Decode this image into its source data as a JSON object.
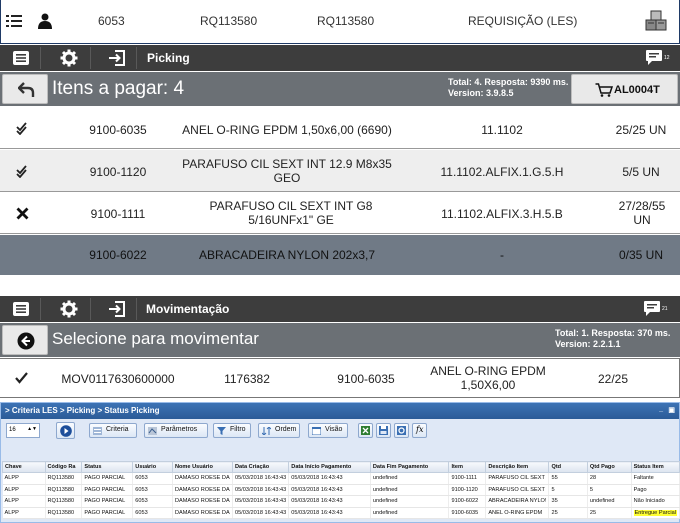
{
  "request_bar": {
    "code": "6053",
    "req_id_1": "RQ113580",
    "req_id_2": "RQ113580",
    "type": "REQUISIÇÃO (LES)",
    "icons": [
      "list-icon",
      "user-icon",
      "boxes-icon"
    ]
  },
  "picking": {
    "toolbar": {
      "title": "Picking",
      "badge": "12"
    },
    "header": {
      "title": "Itens a pagar: 4",
      "stats_line1": "Total: 4. Resposta: 9390 ms.",
      "stats_line2": "Version: 3.9.8.5",
      "cart_label": "AL0004T"
    },
    "rows": [
      {
        "status_icon": "double-check-icon",
        "item": "9100-6035",
        "desc": "ANEL O-RING EPDM 1,50x6,00 (6690)",
        "loc": "11.1102",
        "qty": "25/25 UN"
      },
      {
        "status_icon": "double-check-icon",
        "item": "9100-1120",
        "desc": "PARAFUSO CIL SEXT INT 12.9  M8x35 GEO",
        "loc": "11.1102.ALFIX.1.G.5.H",
        "qty": "5/5 UN"
      },
      {
        "status_icon": "x-icon",
        "item": "9100-1111",
        "desc": "PARAFUSO CIL SEXT INT G8 5/16UNFx1\" GE",
        "loc": "11.1102.ALFIX.3.H.5.B",
        "qty": "27/28/55 UN"
      },
      {
        "status_icon": "",
        "item": "9100-6022",
        "desc": "ABRACADEIRA NYLON 202x3,7",
        "loc": "-",
        "qty": "0/35 UN"
      }
    ]
  },
  "movimentacao": {
    "toolbar": {
      "title": "Movimentação",
      "badge": "21"
    },
    "header": {
      "title": "Selecione para movimentar",
      "stats_line1": "Total: 1. Resposta: 370 ms.",
      "stats_line2": "Version: 2.2.1.1"
    },
    "row": {
      "status_icon": "check-icon",
      "mov": "MOV0117630600000",
      "code": "1176382",
      "item": "9100-6035",
      "desc": "ANEL O-RING EPDM 1,50X6,00",
      "qty": "22/25"
    }
  },
  "criteria": {
    "breadcrumb": "> Criteria LES > Picking > Status Picking",
    "page_size": "16",
    "buttons": {
      "criteria": "Criteria",
      "params": "Parâmetros",
      "filter": "Filtro",
      "order": "Ordem",
      "view": "Visão"
    },
    "columns": [
      "Chave",
      "Código Ra",
      "Status",
      "Usuário",
      "Nome Usuário",
      "Data Criação",
      "Data Início Pagamento",
      "Data Fim Pagamento",
      "Item",
      "Descrição Item",
      "Qtd",
      "Qtd Pago",
      "Status Item"
    ],
    "rows": [
      [
        "ALPP",
        "RQ113580",
        "PAGO PARCIAL",
        "6053",
        "DAMASO ROESE DA",
        "05/03/2018 16:43:43",
        "05/03/2018 16:43:43",
        "undefined",
        "9100-1111",
        "PARAFUSO CIL SEXT",
        "55",
        "28",
        "Faltante"
      ],
      [
        "ALPP",
        "RQ113580",
        "PAGO PARCIAL",
        "6053",
        "DAMASO ROESE DA",
        "05/03/2018 16:43:43",
        "05/03/2018 16:43:43",
        "undefined",
        "9100-1120",
        "PARAFUSO CIL SEXT",
        "5",
        "5",
        "Pago"
      ],
      [
        "ALPP",
        "RQ113580",
        "PAGO PARCIAL",
        "6053",
        "DAMASO ROESE DA",
        "05/03/2018 16:43:43",
        "05/03/2018 16:43:43",
        "undefined",
        "9100-6022",
        "ABRACADEIRA NYLO!",
        "35",
        "undefined",
        "Não Iniciado"
      ],
      [
        "ALPP",
        "RQ113580",
        "PAGO PARCIAL",
        "6053",
        "DAMASO ROESE DA",
        "05/03/2018 16:43:43",
        "05/03/2018 16:43:43",
        "undefined",
        "9100-6035",
        "ANEL O-RING EPDM",
        "25",
        "25",
        "Entregue Parcial"
      ]
    ]
  }
}
